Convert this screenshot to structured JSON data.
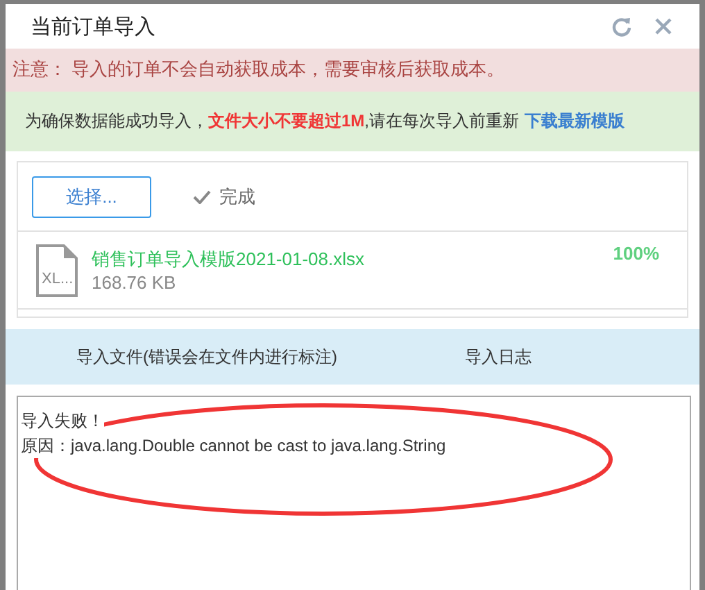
{
  "window": {
    "title": "当前订单导入"
  },
  "warning": "注意： 导入的订单不会自动获取成本，需要审核后获取成本。",
  "notice": {
    "text": "为确保数据能成功导入，**文件大小不要超过1M**,请在每次导入前重新",
    "link": "下载最新模版"
  },
  "upload": {
    "choose_button": "选择...",
    "status": "完成",
    "file": {
      "name": "销售订单导入模版2021-01-08.xlsx",
      "size": "168.76 KB",
      "icon_label": "XL...",
      "percent": "100%"
    }
  },
  "tabs": [
    {
      "label": "导入文件(错误会在文件内进行标注)",
      "selected": false
    },
    {
      "label": "导入日志",
      "selected": false
    }
  ],
  "log": [
    "导入失败！",
    "原因：java.lang.Double cannot be cast to java.lang.String"
  ]
}
